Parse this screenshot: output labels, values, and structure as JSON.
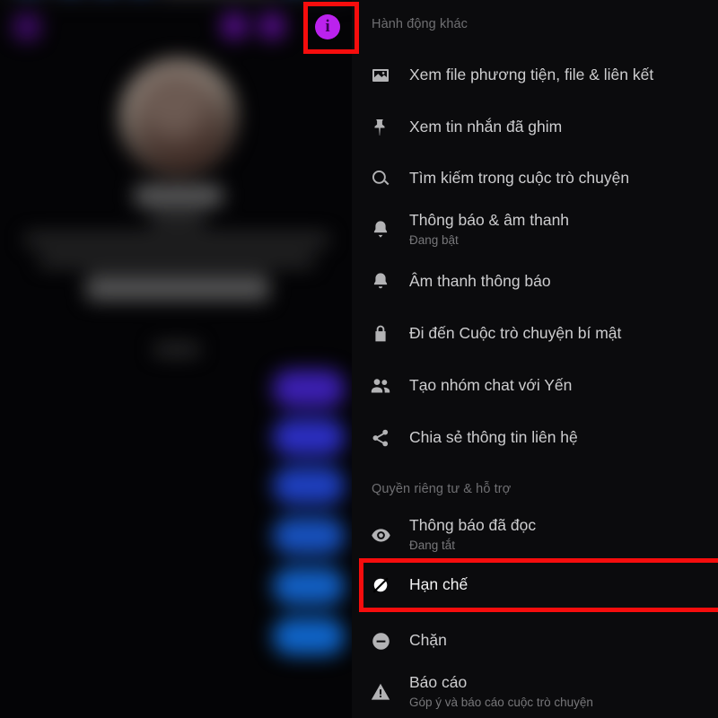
{
  "app": {
    "panel_background": "#0b0b0d",
    "highlight_color": "#f60d0d",
    "accent_color": "#bb22ee"
  },
  "header_bar": {
    "info_icon_label": "i",
    "info_icon_name": "info-icon"
  },
  "menu": {
    "sections": [
      {
        "title": "Hành động khác",
        "items": [
          {
            "icon": "image-icon",
            "label": "Xem file phương tiện, file & liên kết",
            "sub": ""
          },
          {
            "icon": "pin-icon",
            "label": "Xem tin nhắn đã ghim",
            "sub": ""
          },
          {
            "icon": "search-icon",
            "label": "Tìm kiếm trong cuộc trò chuyện",
            "sub": ""
          },
          {
            "icon": "bell-dropdown-icon",
            "label": "Thông báo & âm thanh",
            "sub": "Đang bật"
          },
          {
            "icon": "bell-icon",
            "label": "Âm thanh thông báo",
            "sub": ""
          },
          {
            "icon": "lock-icon",
            "label": "Đi đến Cuộc trò chuyện bí mật",
            "sub": ""
          },
          {
            "icon": "people-icon",
            "label": "Tạo nhóm chat với Yến",
            "sub": ""
          },
          {
            "icon": "share-icon",
            "label": "Chia sẻ thông tin liên hệ",
            "sub": ""
          }
        ]
      },
      {
        "title": "Quyền riêng tư & hỗ trợ",
        "items": [
          {
            "icon": "eye-icon",
            "label": "Thông báo đã đọc",
            "sub": "Đang tắt"
          },
          {
            "icon": "restrict-icon",
            "label": "Hạn chế",
            "sub": ""
          },
          {
            "icon": "block-icon",
            "label": "Chặn",
            "sub": ""
          },
          {
            "icon": "warning-icon",
            "label": "Báo cáo",
            "sub": "Góp ý và báo cáo cuộc trò chuyện"
          }
        ]
      }
    ]
  },
  "highlights": [
    {
      "name": "info-button-highlight",
      "target": "info-icon"
    },
    {
      "name": "restrict-row-highlight",
      "target": "Hạn chế"
    }
  ]
}
